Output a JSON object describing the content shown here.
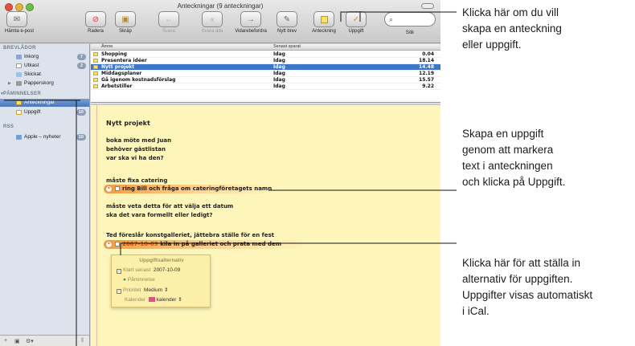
{
  "window": {
    "title": "Anteckningar (9 anteckningar)"
  },
  "toolbar": {
    "get_mail": "Hämta e-post",
    "delete": "Radera",
    "junk": "Skräp",
    "reply": "Svara",
    "reply_all": "Svara alla",
    "forward": "Vidarebefordra",
    "new_message": "Nytt brev",
    "note": "Anteckning",
    "todo": "Uppgift",
    "search_label": "Sök",
    "search_placeholder": ""
  },
  "sidebar": {
    "mailboxes_header": "BREVLÅDOR",
    "reminders_header": "PÅMINNELSER",
    "rss_header": "RSS",
    "mailboxes": [
      {
        "label": "Inkorg",
        "badge": "7"
      },
      {
        "label": "Utkast",
        "badge": "2"
      },
      {
        "label": "Skickat",
        "badge": ""
      },
      {
        "label": "Papperskorg",
        "badge": ""
      }
    ],
    "reminders": [
      {
        "label": "Anteckningar",
        "badge": ""
      },
      {
        "label": "Uppgift",
        "badge": "10"
      }
    ],
    "rss": [
      {
        "label": "Apple – nyheter",
        "badge": "10"
      }
    ]
  },
  "list": {
    "col_subject": "Ämne",
    "col_saved": "Senast sparat",
    "rows": [
      {
        "subject": "Shopping",
        "date": "Idag",
        "time": "0.04"
      },
      {
        "subject": "Presentera idéer",
        "date": "Idag",
        "time": "18.14"
      },
      {
        "subject": "Nytt projekt",
        "date": "Idag",
        "time": "14.48"
      },
      {
        "subject": "Middagsplaner",
        "date": "Idag",
        "time": "12.19"
      },
      {
        "subject": "Gå igenom kostnadsförslag",
        "date": "Idag",
        "time": "15.57"
      },
      {
        "subject": "Arbetstiller",
        "date": "Idag",
        "time": "9.22"
      }
    ]
  },
  "note": {
    "title": "Nytt projekt",
    "p1": [
      "boka möte med Juan",
      "behöver gästlistan",
      "var ska vi ha den?"
    ],
    "p2": "måste fixa catering",
    "task1": "ring Bill och fråga om cateringföretagets namn",
    "p3": [
      "måste veta detta för att välja ett datum",
      "ska det vara formellt eller ledigt?"
    ],
    "p4": "Ted föreslår konstgalleriet, jättebra ställe för en fest",
    "task2_due": "2007-10-09",
    "task2": "kila in på galleriet och prata med dem"
  },
  "task_popup": {
    "title": "Uppgiftsalternativ",
    "due_label": "Klart senast",
    "due_value": "2007-10-09",
    "alarm_label": "Påminnelse",
    "priority_label": "Prioritet",
    "priority_value": "Medium ⇕",
    "calendar_label": "Kalender",
    "calendar_value": "kalender ⇕"
  },
  "callouts": {
    "c1": [
      "Klicka här om du vill",
      "skapa en anteckning",
      "eller uppgift."
    ],
    "c2": [
      "Skapa en uppgift",
      "genom att markera",
      "text i anteckningen",
      "och klicka på Uppgift."
    ],
    "c3": [
      "Klicka här för att ställa in",
      "alternativ för uppgiften.",
      "Uppgifter visas automatiskt",
      "i iCal."
    ]
  },
  "colors": {
    "selection": "#3d75c9",
    "note_paper": "#fdf5ba",
    "task_highlight": "#f39a3a"
  }
}
